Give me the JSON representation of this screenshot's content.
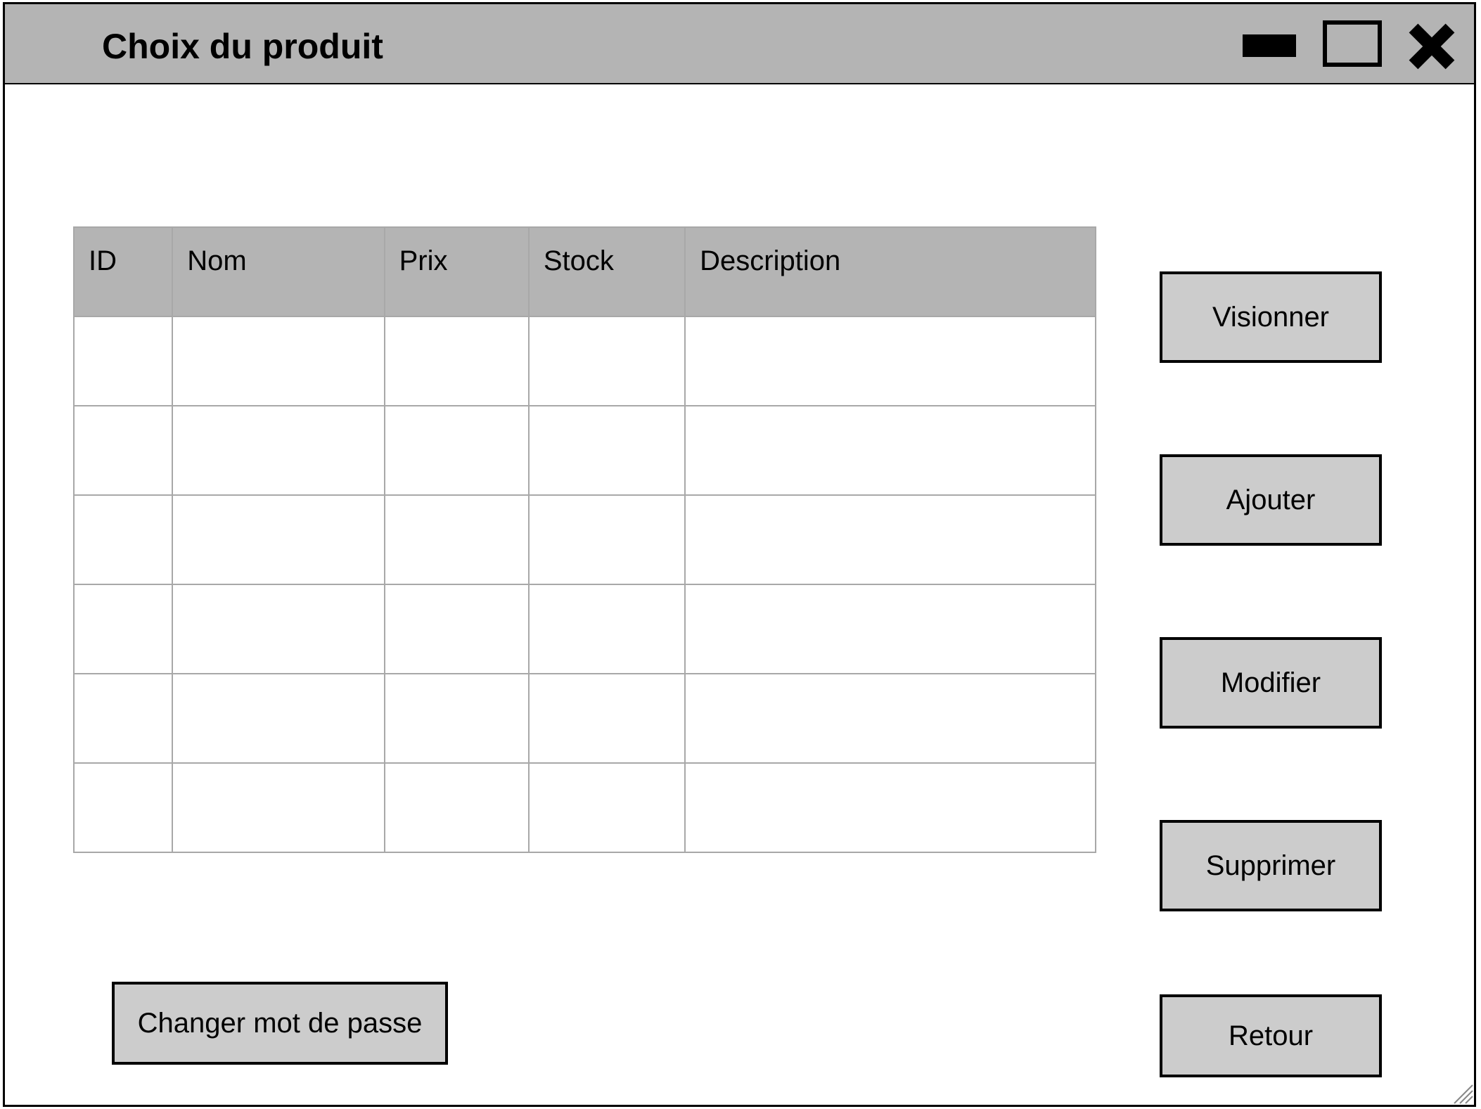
{
  "window": {
    "title": "Choix du produit",
    "controls": {
      "minimize_icon": "minimize-icon",
      "maximize_icon": "maximize-icon",
      "close_icon": "close-icon"
    }
  },
  "table": {
    "columns": [
      "ID",
      "Nom",
      "Prix",
      "Stock",
      "Description"
    ],
    "rows": [
      [
        "",
        "",
        "",
        "",
        ""
      ],
      [
        "",
        "",
        "",
        "",
        ""
      ],
      [
        "",
        "",
        "",
        "",
        ""
      ],
      [
        "",
        "",
        "",
        "",
        ""
      ],
      [
        "",
        "",
        "",
        "",
        ""
      ],
      [
        "",
        "",
        "",
        "",
        ""
      ]
    ]
  },
  "actions": {
    "view_label": "Visionner",
    "add_label": "Ajouter",
    "edit_label": "Modifier",
    "delete_label": "Supprimer",
    "back_label": "Retour",
    "change_password_label": "Changer mot de passe"
  },
  "colors": {
    "titlebar": "#b4b4b4",
    "button": "#cccccc",
    "grid": "#a8a8a8",
    "border": "#000000"
  }
}
